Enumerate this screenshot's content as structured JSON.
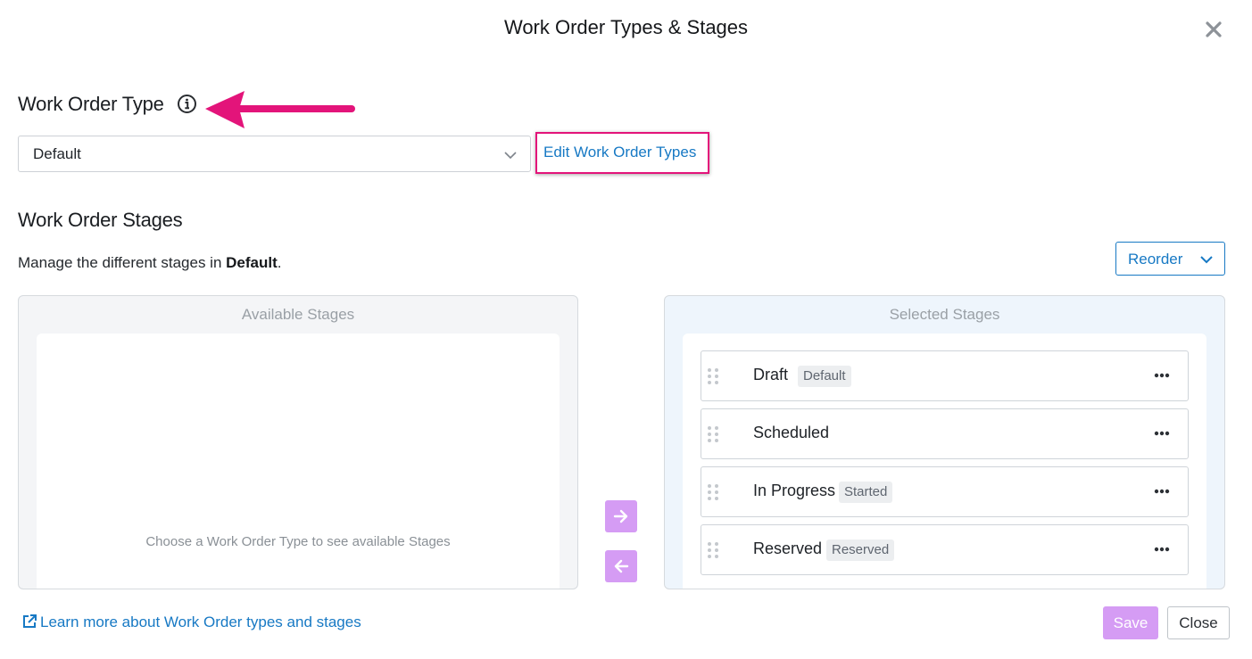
{
  "modal": {
    "title": "Work Order Types & Stages"
  },
  "work_order_type": {
    "heading": "Work Order Type",
    "selected": "Default",
    "edit_link": "Edit Work Order Types"
  },
  "work_order_stages": {
    "heading": "Work Order Stages",
    "manage_prefix": "Manage the different stages in ",
    "manage_type": "Default",
    "manage_suffix": ".",
    "reorder_label": "Reorder"
  },
  "available_panel": {
    "heading": "Available Stages",
    "empty_message": "Choose a Work Order Type to see available Stages"
  },
  "selected_panel": {
    "heading": "Selected Stages",
    "stages": [
      {
        "name": "Draft",
        "badge": "Default"
      },
      {
        "name": "Scheduled",
        "badge": ""
      },
      {
        "name": "In Progress",
        "badge": "Started"
      },
      {
        "name": "Reserved",
        "badge": "Reserved"
      }
    ]
  },
  "footer": {
    "learn_more": "Learn more about Work Order types and stages",
    "save_label": "Save",
    "close_label": "Close"
  },
  "colors": {
    "accent_blue": "#1779c4",
    "annotation_pink": "#e3147a",
    "disabled_purple": "#d59cf4"
  },
  "icons": {
    "close": "close-icon",
    "info": "info-icon",
    "chevron": "chevron-down-icon",
    "drag": "drag-handle-icon",
    "more": "more-icon",
    "arrow_right": "arrow-right-icon",
    "arrow_left": "arrow-left-icon",
    "external_link": "external-link-icon"
  }
}
